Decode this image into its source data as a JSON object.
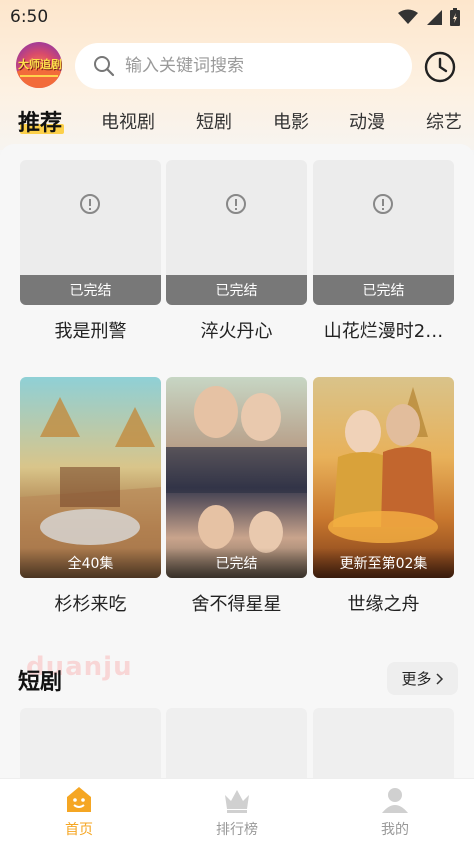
{
  "status_bar": {
    "time": "6:50"
  },
  "header": {
    "logo_text": "大师追剧",
    "search_placeholder": "输入关键词搜索",
    "search_icon": "search-icon",
    "history_icon": "clock-icon"
  },
  "tabs": [
    {
      "label": "推荐",
      "active": true
    },
    {
      "label": "电视剧",
      "active": false
    },
    {
      "label": "短剧",
      "active": false
    },
    {
      "label": "电影",
      "active": false
    },
    {
      "label": "动漫",
      "active": false
    },
    {
      "label": "综艺",
      "active": false
    }
  ],
  "row1": [
    {
      "title": "我是刑警",
      "badge": "已完结"
    },
    {
      "title": "淬火丹心",
      "badge": "已完结"
    },
    {
      "title": "山花烂漫时2…",
      "badge": "已完结"
    }
  ],
  "row2": [
    {
      "title": "杉杉来吃",
      "badge": "全40集"
    },
    {
      "title": "舍不得星星",
      "badge": "已完结"
    },
    {
      "title": "世缘之舟",
      "badge": "更新至第02集"
    }
  ],
  "section": {
    "title": "短剧",
    "watermark": "duanju",
    "more_label": "更多"
  },
  "bottom_nav": [
    {
      "label": "首页",
      "icon": "home-icon",
      "active": true
    },
    {
      "label": "排行榜",
      "icon": "crown-icon",
      "active": false
    },
    {
      "label": "我的",
      "icon": "user-icon",
      "active": false
    }
  ],
  "colors": {
    "accent": "#f5a623",
    "tab_highlight": "#fcd04a"
  }
}
